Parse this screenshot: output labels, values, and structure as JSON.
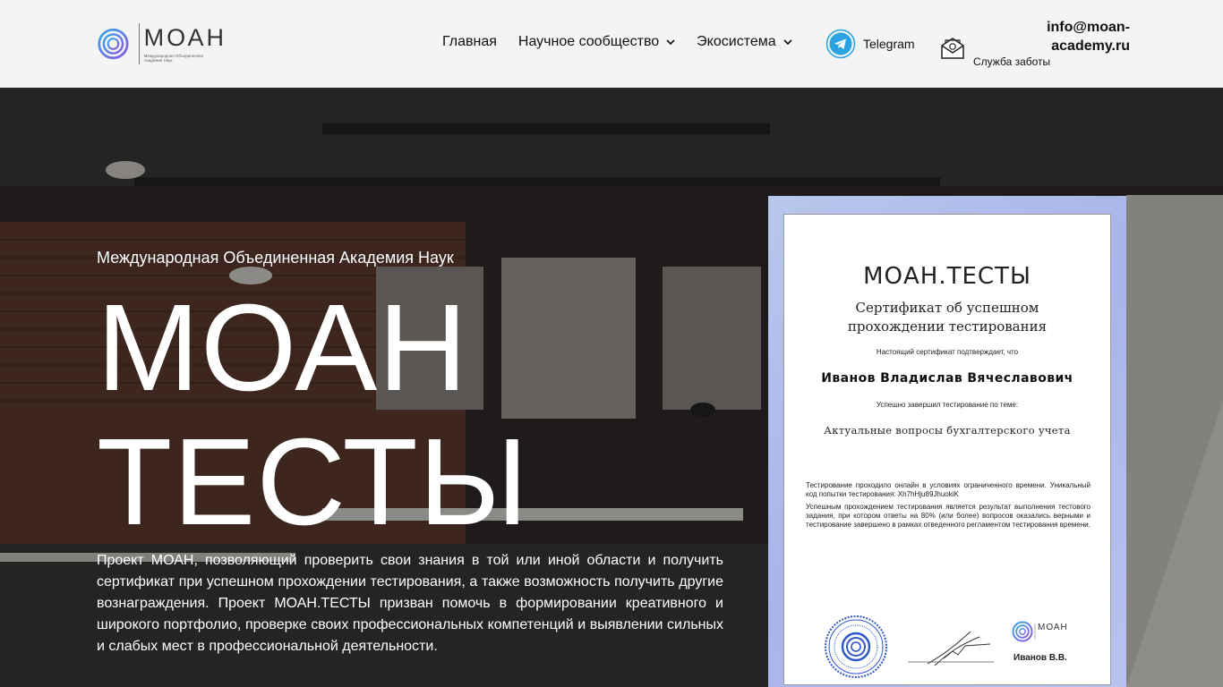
{
  "header": {
    "logo": {
      "name": "МОАН",
      "subtitle": "Международная Объединенная Академия Наук"
    },
    "nav": [
      {
        "label": "Главная",
        "dropdown": false
      },
      {
        "label": "Научное сообщество",
        "dropdown": true
      },
      {
        "label": "Экосистема",
        "dropdown": true
      }
    ],
    "telegram": {
      "label": "Telegram",
      "icon": "telegram-icon"
    },
    "contact": {
      "email": "info@moan-academy.ru",
      "label": "Служба заботы",
      "icon": "mail-icon"
    }
  },
  "hero": {
    "subtitle": "Международная Объединенная Академия Наук",
    "title_line1": "МОАН",
    "title_line2": "ТЕСТЫ",
    "description": "Проект МОАН, позволяющий проверить свои знания в той или иной области и получить сертификат при успешном прохождении тестирования, а также возможность получить другие вознаграждения. Проект МОАН.ТЕСТЫ призван помочь в формировании креативного и широкого портфолио, проверке своих профессиональных компетенций и выявлении сильных и слабых мест в профессиональной деятельности."
  },
  "certificate": {
    "brand": "МОАН.ТЕСТЫ",
    "heading_line1": "Сертификат об успешном",
    "heading_line2": "прохождении тестирования",
    "confirm_text": "Настоящий сертификат подтверждает, что",
    "name": "Иванов Владислав Вячеславович",
    "passed_text": "Успешно завершил тестирование по теме:",
    "topic": "Актуальные вопросы бухгалтерского учета",
    "info_line1": "Тестирование проходило онлайн в условиях ограниченного времени. Уникальный код попытки тестирования: Xh7hHju89JhuokiK",
    "info_line2": "Успешным прохождением тестирования является результат выполнения тестового задания, при котором ответы на 80% (или более) вопросов оказались верными и тестирование завершено в рамках отведенного регламентом тестирования времени.",
    "logo_name": "МОАН",
    "signer": "Иванов В.В."
  },
  "colors": {
    "header_bg": "#f4f4f4",
    "hero_text": "#ffffff",
    "cert_frame": "#b8c7ec",
    "logo_blue": "#3f7fd9",
    "logo_purple": "#7a5ce0",
    "telegram_blue": "#2aa3e0"
  }
}
